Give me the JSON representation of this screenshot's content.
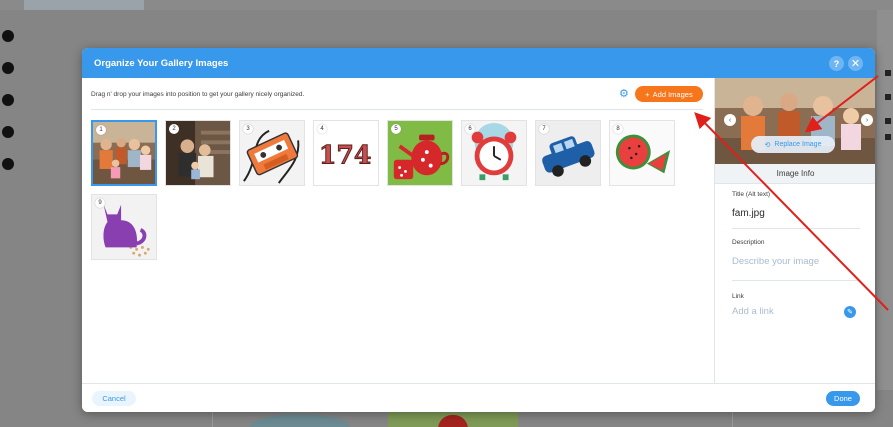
{
  "modal": {
    "title": "Organize Your Gallery Images",
    "help_label": "?",
    "close_label": "✕",
    "instructions": "Drag n' drop your images into position to get your gallery nicely organized.",
    "add_images_label": "Add Images",
    "add_images_plus": "+"
  },
  "thumbnails": [
    {
      "index": "1",
      "name": "fam-photo"
    },
    {
      "index": "2",
      "name": "family-photo-2"
    },
    {
      "index": "3",
      "name": "cassette-tape"
    },
    {
      "index": "4",
      "name": "number-174"
    },
    {
      "index": "5",
      "name": "red-teapot"
    },
    {
      "index": "6",
      "name": "alarm-clock"
    },
    {
      "index": "7",
      "name": "blue-car"
    },
    {
      "index": "8",
      "name": "watermelon"
    },
    {
      "index": "9",
      "name": "purple-cat"
    }
  ],
  "sidebar": {
    "replace_image_label": "Replace Image",
    "image_info_label": "Image Info",
    "title_label": "Title (Alt text)",
    "title_value": "fam.jpg",
    "description_label": "Description",
    "description_placeholder": "Describe your image",
    "link_label": "Link",
    "link_placeholder": "Add a link"
  },
  "footer": {
    "cancel_label": "Cancel",
    "done_label": "Done"
  },
  "colors": {
    "accent": "#3899ec",
    "add_button": "#f7761b",
    "annotation": "#e0201a"
  }
}
